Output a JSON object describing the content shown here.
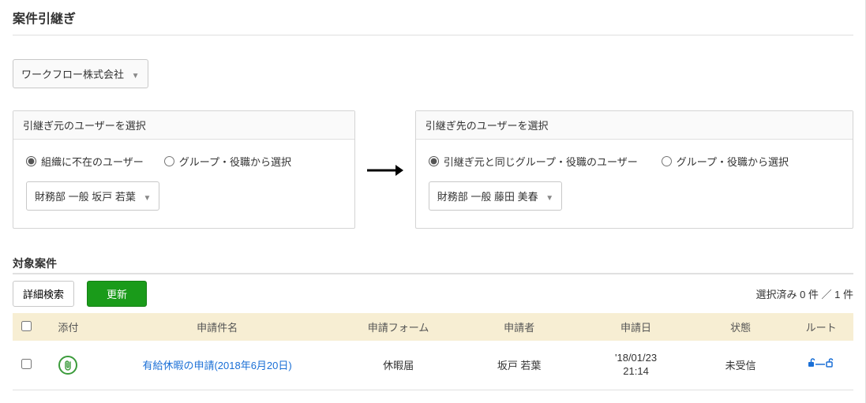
{
  "title": "案件引継ぎ",
  "company_select": "ワークフロー株式会社",
  "source_panel": {
    "header": "引継ぎ元のユーザーを選択",
    "opt1": "組織に不在のユーザー",
    "opt2": "グループ・役職から選択",
    "user_select": "財務部 一般 坂戸 若葉"
  },
  "dest_panel": {
    "header": "引継ぎ先のユーザーを選択",
    "opt1": "引継ぎ元と同じグループ・役職のユーザー",
    "opt2": "グループ・役職から選択",
    "user_select": "財務部 一般 藤田 美春"
  },
  "target_section": "対象案件",
  "detail_search": "詳細検索",
  "update": "更新",
  "selected_status": "選択済み 0 件 ／ 1 件",
  "columns": {
    "attach": "添付",
    "name": "申請件名",
    "form": "申請フォーム",
    "applicant": "申請者",
    "date": "申請日",
    "state": "状態",
    "route": "ルート"
  },
  "row": {
    "name": "有給休暇の申請(2018年6月20日)",
    "form": "休暇届",
    "applicant": "坂戸 若葉",
    "date_line1": "'18/01/23",
    "date_line2": "21:14",
    "state": "未受信"
  }
}
